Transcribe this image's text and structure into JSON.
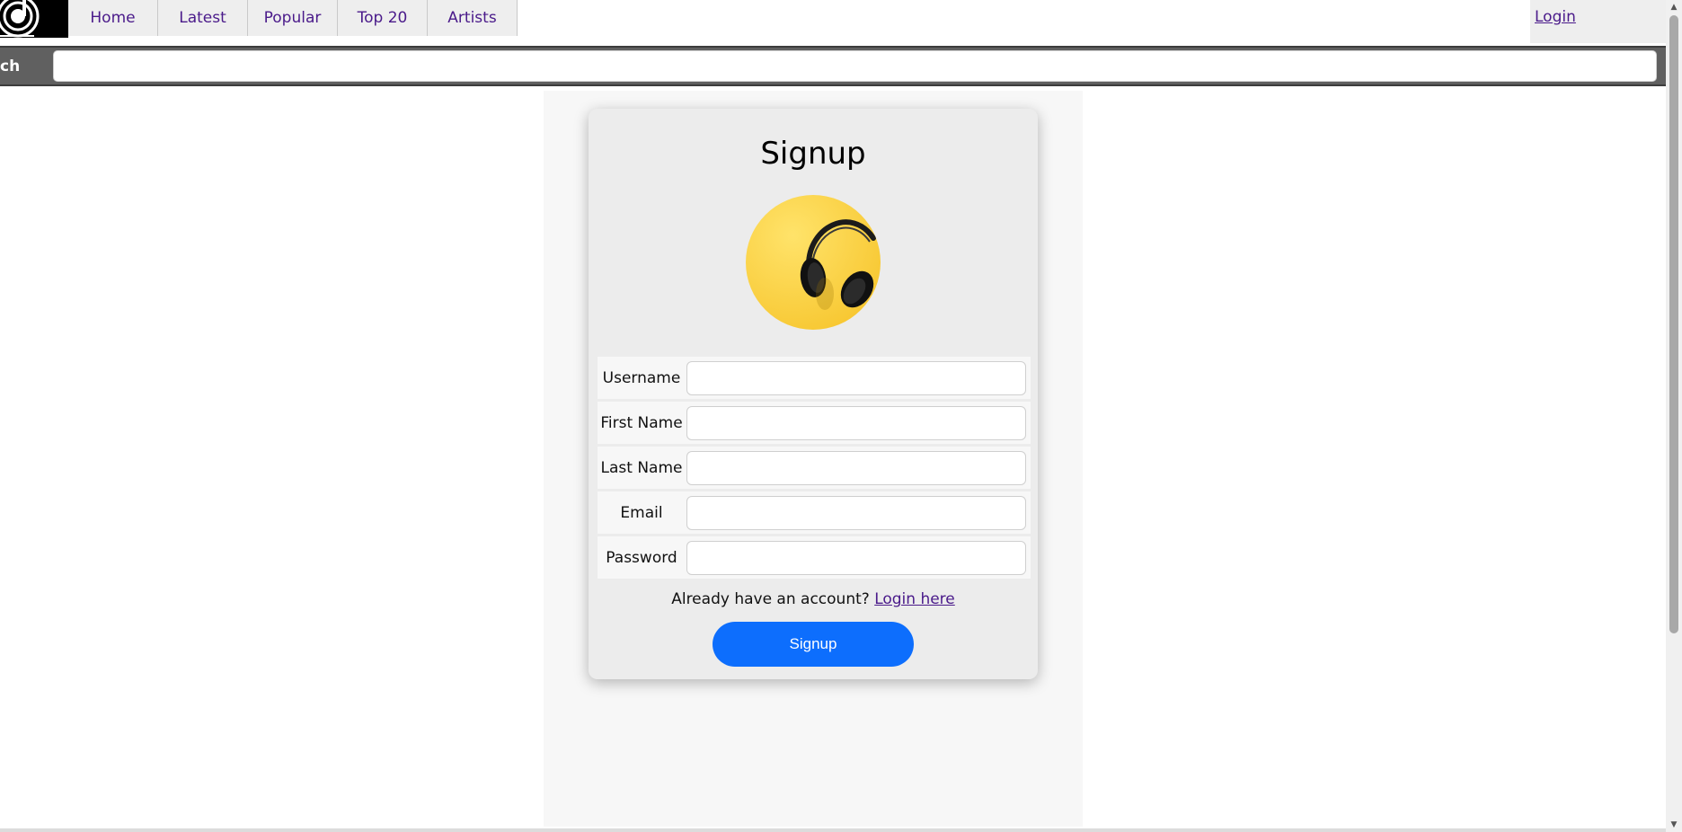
{
  "nav": {
    "items": [
      {
        "label": "Home"
      },
      {
        "label": "Latest"
      },
      {
        "label": "Popular"
      },
      {
        "label": "Top 20"
      },
      {
        "label": "Artists"
      }
    ],
    "login_label": "Login",
    "link_color": "#4a1a8a"
  },
  "search": {
    "label": "ch",
    "value": ""
  },
  "form": {
    "title": "Signup",
    "fields": [
      {
        "label": "Username",
        "value": ""
      },
      {
        "label": "First Name",
        "value": ""
      },
      {
        "label": "Last Name",
        "value": ""
      },
      {
        "label": "Email",
        "value": ""
      },
      {
        "label": "Password",
        "value": ""
      }
    ],
    "already_text": "Already have an account?",
    "login_link": "Login here",
    "submit_label": "Signup",
    "accent_color": "#0d6efd"
  },
  "icons": {
    "logo": "music-note-logo-icon",
    "avatar": "headphones-icon"
  }
}
